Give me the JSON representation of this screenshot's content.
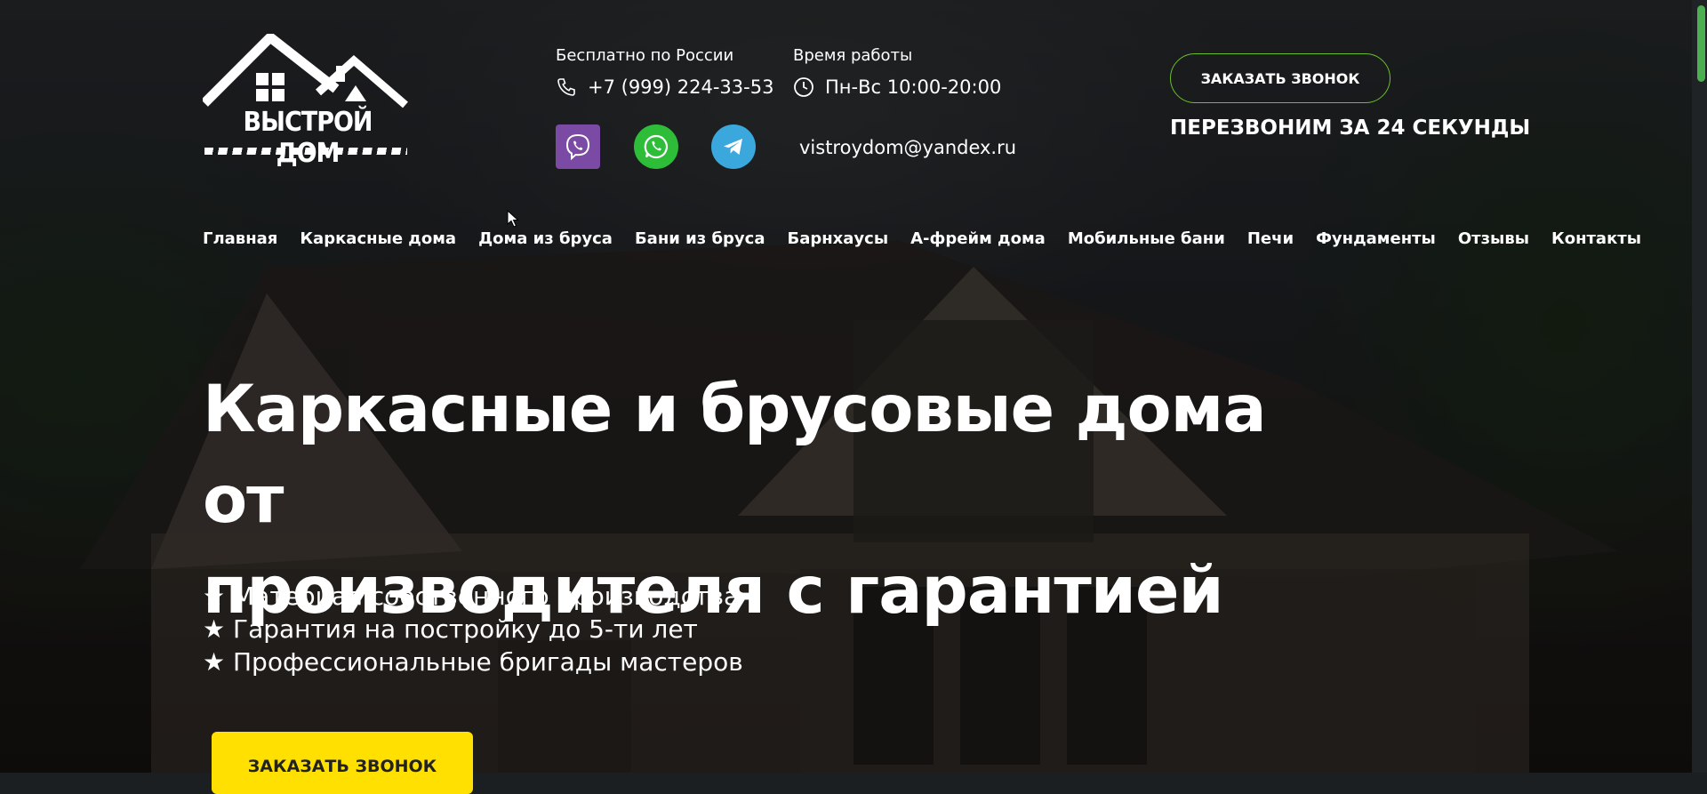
{
  "logo": {
    "text": "ВЫСТРОЙ ДОМ"
  },
  "contacts": {
    "free_label": "Бесплатно по России",
    "phone": "+7 (999) 224-33-53",
    "hours_label": "Время работы",
    "hours": "Пн-Вс 10:00-20:00",
    "email": "vistroydom@yandex.ru",
    "messengers": [
      "viber-icon",
      "whatsapp-icon",
      "telegram-icon"
    ]
  },
  "callback": {
    "button_label": "ЗАКАЗАТЬ ЗВОНОК",
    "note": "ПЕРЕЗВОНИМ ЗА 24 СЕКУНДЫ"
  },
  "nav": {
    "items": [
      "Главная",
      "Каркасные дома",
      "Дома из бруса",
      "Бани из бруса",
      "Барнхаусы",
      "А-фрейм дома",
      "Мобильные бани",
      "Печи",
      "Фундаменты",
      "Отзывы",
      "Контакты"
    ]
  },
  "hero": {
    "title_line1": "Каркасные и брусовые дома от",
    "title_line2": "производителя с гарантией",
    "features": [
      "★ Материал собственного производства",
      "★ Гарантия на постройку до 5-ти лет",
      "★ Профессиональные бригады мастеров"
    ],
    "cta_label": "ЗАКАЗАТЬ ЗВОНОК"
  },
  "colors": {
    "accent_green": "#6bbf2a",
    "cta_yellow": "#ffe001",
    "viber": "#7b4aa5",
    "whatsapp": "#2ebd39",
    "telegram": "#3aa7dd",
    "scrollbar": "#4caf50"
  }
}
